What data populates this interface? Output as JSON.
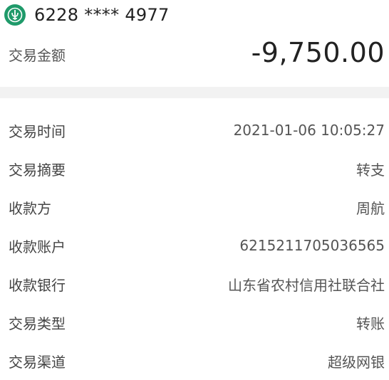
{
  "header": {
    "bank_logo_icon": "abc-bank-logo-icon",
    "brand_color": "#1f9a6a",
    "account_number": "6228 **** 4977",
    "amount_label": "交易金额",
    "amount_value": "-9,750.00"
  },
  "details": [
    {
      "label": "交易时间",
      "value": "2021-01-06 10:05:27"
    },
    {
      "label": "交易摘要",
      "value": "转支"
    },
    {
      "label": "收款方",
      "value": "周航"
    },
    {
      "label": "收款账户",
      "value": "6215211705036565"
    },
    {
      "label": "收款银行",
      "value": "山东省农村信用社联合社"
    },
    {
      "label": "交易类型",
      "value": "转账"
    },
    {
      "label": "交易渠道",
      "value": "超级网银"
    }
  ]
}
